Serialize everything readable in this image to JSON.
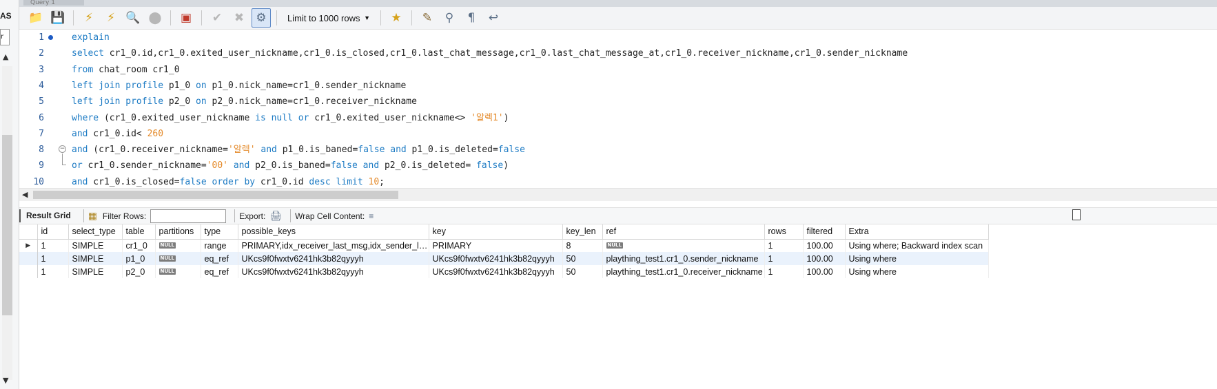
{
  "window": {
    "tab_label": "Query 1",
    "left_fragment": "AS",
    "left_input_value": "r"
  },
  "toolbar": {
    "limit_label": "Limit to 1000 rows"
  },
  "editor": {
    "lines": [
      {
        "n": "1",
        "html": "<span class='kw'>explain</span>"
      },
      {
        "n": "2",
        "html": "<span class='kw'>select</span> cr1_0.id,cr1_0.exited_user_nickname,cr1_0.is_closed,cr1_0.last_chat_message,cr1_0.last_chat_message_at,cr1_0.receiver_nickname,cr1_0.sender_nickname"
      },
      {
        "n": "3",
        "html": "<span class='kw'>from</span> chat_room cr1_0"
      },
      {
        "n": "4",
        "html": "<span class='kw'>left join</span> <span class='kw'>profile</span> p1_0 <span class='kw'>on</span> p1_0.nick_name=cr1_0.sender_nickname"
      },
      {
        "n": "5",
        "html": "<span class='kw'>left join</span> <span class='kw'>profile</span> p2_0 <span class='kw'>on</span> p2_0.nick_name=cr1_0.receiver_nickname"
      },
      {
        "n": "6",
        "html": "<span class='kw'>where</span> (cr1_0.exited_user_nickname <span class='kw'>is null or</span> cr1_0.exited_user_nickname&lt;&gt; <span class='str'>'알렉1'</span>)"
      },
      {
        "n": "7",
        "html": "<span class='kw'>and</span> cr1_0.id&lt; <span class='num'>260</span>"
      },
      {
        "n": "8",
        "html": "<span class='kw'>and</span> (cr1_0.receiver_nickname=<span class='str'>'알렉'</span> <span class='kw'>and</span> p1_0.is_baned=<span class='kw'>false and</span> p1_0.is_deleted=<span class='kw'>false</span>"
      },
      {
        "n": "9",
        "html": "<span class='kw'>or</span> cr1_0.sender_nickname=<span class='str'>'00'</span> <span class='kw'>and</span> p2_0.is_baned=<span class='kw'>false and</span> p2_0.is_deleted= <span class='kw'>false</span>)"
      },
      {
        "n": "10",
        "html": "<span class='kw'>and</span> cr1_0.is_closed=<span class='kw'>false order by</span> cr1_0.id <span class='kw'>desc limit</span> <span class='num'>10</span>;"
      }
    ]
  },
  "result_toolbar": {
    "result_tab": "Result Grid",
    "filter_label": "Filter Rows:",
    "filter_value": "",
    "export_label": "Export:",
    "wrap_label": "Wrap Cell Content:"
  },
  "grid": {
    "null_label": "NULL",
    "columns": [
      "id",
      "select_type",
      "table",
      "partitions",
      "type",
      "possible_keys",
      "key",
      "key_len",
      "ref",
      "rows",
      "filtered",
      "Extra"
    ],
    "rows": [
      [
        "1",
        "SIMPLE",
        "cr1_0",
        null,
        "range",
        "PRIMARY,idx_receiver_last_msg,idx_sender_la...",
        "PRIMARY",
        "8",
        null,
        "1",
        "100.00",
        "Using where; Backward index scan"
      ],
      [
        "1",
        "SIMPLE",
        "p1_0",
        null,
        "eq_ref",
        "UKcs9f0fwxtv6241hk3b82qyyyh",
        "UKcs9f0fwxtv6241hk3b82qyyyh",
        "50",
        "plaything_test1.cr1_0.sender_nickname",
        "1",
        "100.00",
        "Using where"
      ],
      [
        "1",
        "SIMPLE",
        "p2_0",
        null,
        "eq_ref",
        "UKcs9f0fwxtv6241hk3b82qyyyh",
        "UKcs9f0fwxtv6241hk3b82qyyyh",
        "50",
        "plaything_test1.cr1_0.receiver_nickname",
        "1",
        "100.00",
        "Using where"
      ]
    ]
  }
}
